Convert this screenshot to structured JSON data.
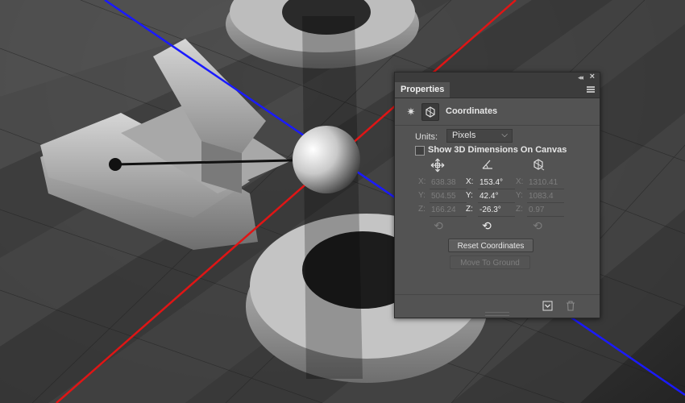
{
  "panel": {
    "tab_label": "Properties",
    "section_title": "Coordinates",
    "icons": {
      "collapse": "double-chevron-icon",
      "close": "close-icon",
      "menu": "panel-menu-icon",
      "light": "light-icon",
      "coordinates": "coordinates-icon",
      "position": "move-position-icon",
      "rotation": "angle-rotation-icon",
      "scale": "scale-cube-icon",
      "reset": "reset-arrow-icon",
      "render_to_file": "render-icon",
      "delete": "trash-icon"
    },
    "units_label": "Units:",
    "units_value": "Pixels",
    "show_dims_label": "Show 3D Dimensions On Canvas",
    "show_dims_checked": false,
    "position": {
      "x_label": "X:",
      "x": "638.38",
      "y_label": "Y:",
      "y": "504.55",
      "z_label": "Z:",
      "z": "166.24"
    },
    "rotation": {
      "x_label": "X:",
      "x": "153.4°",
      "y_label": "Y:",
      "y": "42.4°",
      "z_label": "Z:",
      "z": "-26.3°"
    },
    "scale": {
      "x_label": "X:",
      "x": "1310.41",
      "y_label": "Y:",
      "y": "1083.4",
      "z_label": "Z:",
      "z": "0.97"
    },
    "reset_coordinates_label": "Reset Coordinates",
    "move_to_ground_label": "Move To Ground",
    "colors": {
      "panel_bg": "#535353",
      "titlebar_bg": "#3c3c3c",
      "axis_x": "#d21414",
      "axis_z": "#1414d2"
    }
  }
}
